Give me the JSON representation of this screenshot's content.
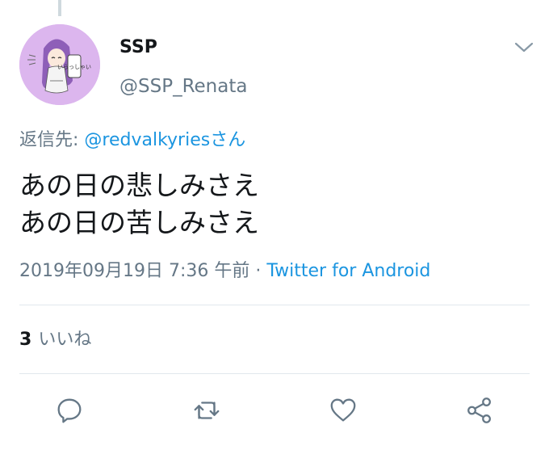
{
  "tweet": {
    "display_name": "SSP",
    "username": "@SSP_Renata",
    "reply_prefix": "返信先: ",
    "reply_mention": "@redvalkyriesさん",
    "text_lines": [
      "あの日の悲しみさえ",
      "あの日の苦しみさえ"
    ],
    "timestamp": "2019年09月19日 7:36 午前",
    "separator": " · ",
    "source": "Twitter for Android",
    "like_count": "3",
    "like_label": "いいね",
    "avatar_text": "いらっしゃい"
  },
  "icons": {
    "menu": "chevron-down-icon",
    "reply": "reply-icon",
    "retweet": "retweet-icon",
    "like": "heart-icon",
    "share": "share-icon"
  },
  "colors": {
    "link": "#1b95e0",
    "secondary_text": "#657786",
    "primary_text": "#14171a",
    "divider": "#e1e8ed",
    "avatar_bg": "#dcb6ee"
  }
}
